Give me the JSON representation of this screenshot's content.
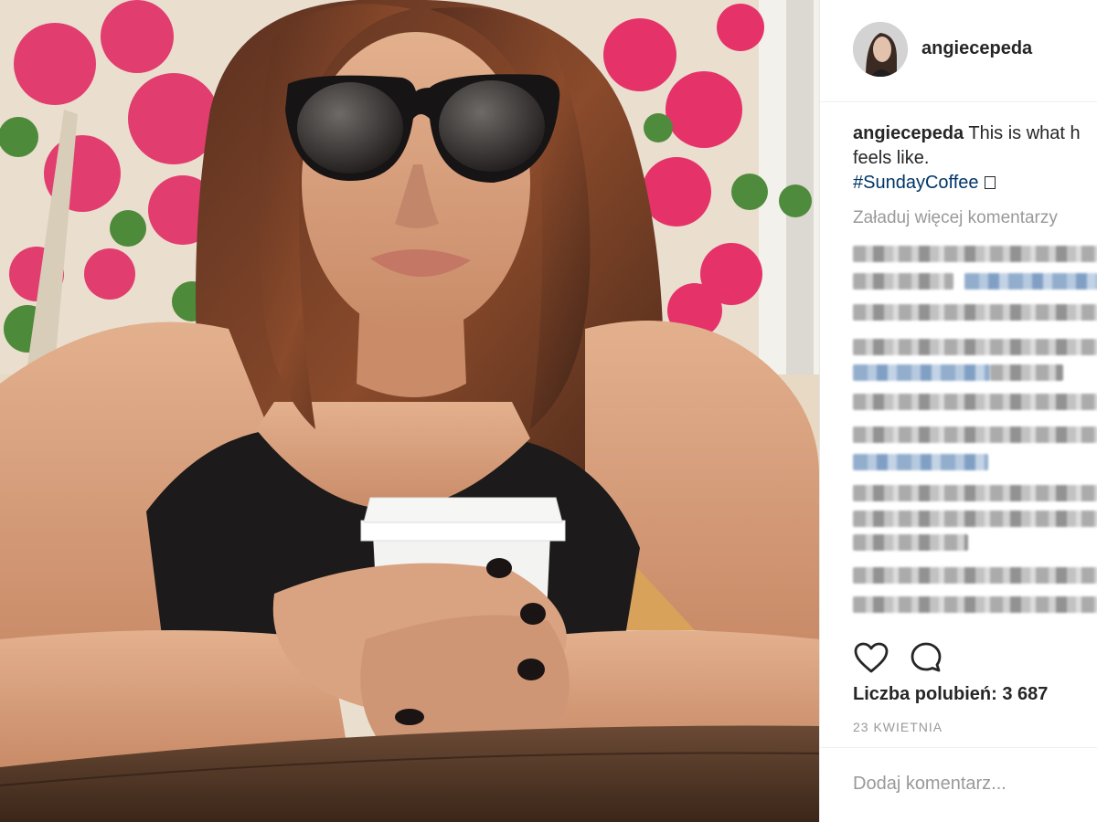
{
  "post": {
    "username": "angiecepeda",
    "caption_text": "This is what h",
    "caption_line2": "feels like.",
    "hashtag": "#SundayCoffee",
    "load_more": "Załaduj więcej komentarzy",
    "likes": "Liczba polubień: 3 687",
    "date": "23 KWIETNIA",
    "comment_placeholder": "Dodaj komentarz..."
  },
  "icons": {
    "like": "heart-icon",
    "comment": "comment-bubble-icon"
  },
  "colors": {
    "text": "#262626",
    "muted": "#999999",
    "hashtag": "#003569",
    "border": "#efefef"
  }
}
